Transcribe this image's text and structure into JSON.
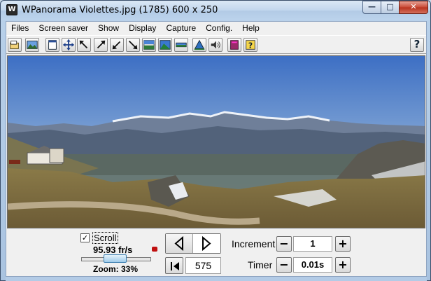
{
  "window": {
    "title": "WPanorama  Violettes.jpg   (1785) 600 x 250",
    "app_icon_glyph": "W",
    "controls": {
      "minimize": "—",
      "maximize": "□",
      "close": "✕"
    }
  },
  "menubar": {
    "items": [
      "Files",
      "Screen saver",
      "Show",
      "Display",
      "Capture",
      "Config.",
      "Help"
    ]
  },
  "toolbar": {
    "buttons": [
      {
        "name": "open-file-icon"
      },
      {
        "name": "picture-icon"
      },
      {
        "name": "window-size-icon"
      },
      {
        "name": "fit-arrows-icon"
      },
      {
        "name": "arrow-up-left-icon"
      },
      {
        "name": "arrow-up-right-icon"
      },
      {
        "name": "arrow-down-left-icon"
      },
      {
        "name": "arrow-down-right-icon"
      },
      {
        "name": "display-mode-icon"
      },
      {
        "name": "landscape-fill-icon"
      },
      {
        "name": "horizon-strip-icon"
      },
      {
        "name": "mountain-triangle-icon"
      },
      {
        "name": "sound-icon"
      },
      {
        "name": "book-icon"
      },
      {
        "name": "context-help-icon"
      }
    ],
    "help_label": "?"
  },
  "controls": {
    "scroll_checked": true,
    "scroll_check_glyph": "✓",
    "scroll_label": "Scroll",
    "fps": "95.93 fr/s",
    "zoom": "Zoom: 33%",
    "zoom_fraction": 0.33,
    "nav_left_glyph": "◁",
    "nav_right_glyph": "▷",
    "first_glyph": "|◀",
    "frame_value": "575",
    "increment_label": "Increment",
    "increment_value": "1",
    "timer_label": "Timer",
    "timer_value": "0.01s",
    "minus_glyph": "−",
    "plus_glyph": "+"
  },
  "colors": {
    "sky_top": "#3d6fc4",
    "sky_horizon": "#b3cde6",
    "accent_red": "#c01010"
  }
}
